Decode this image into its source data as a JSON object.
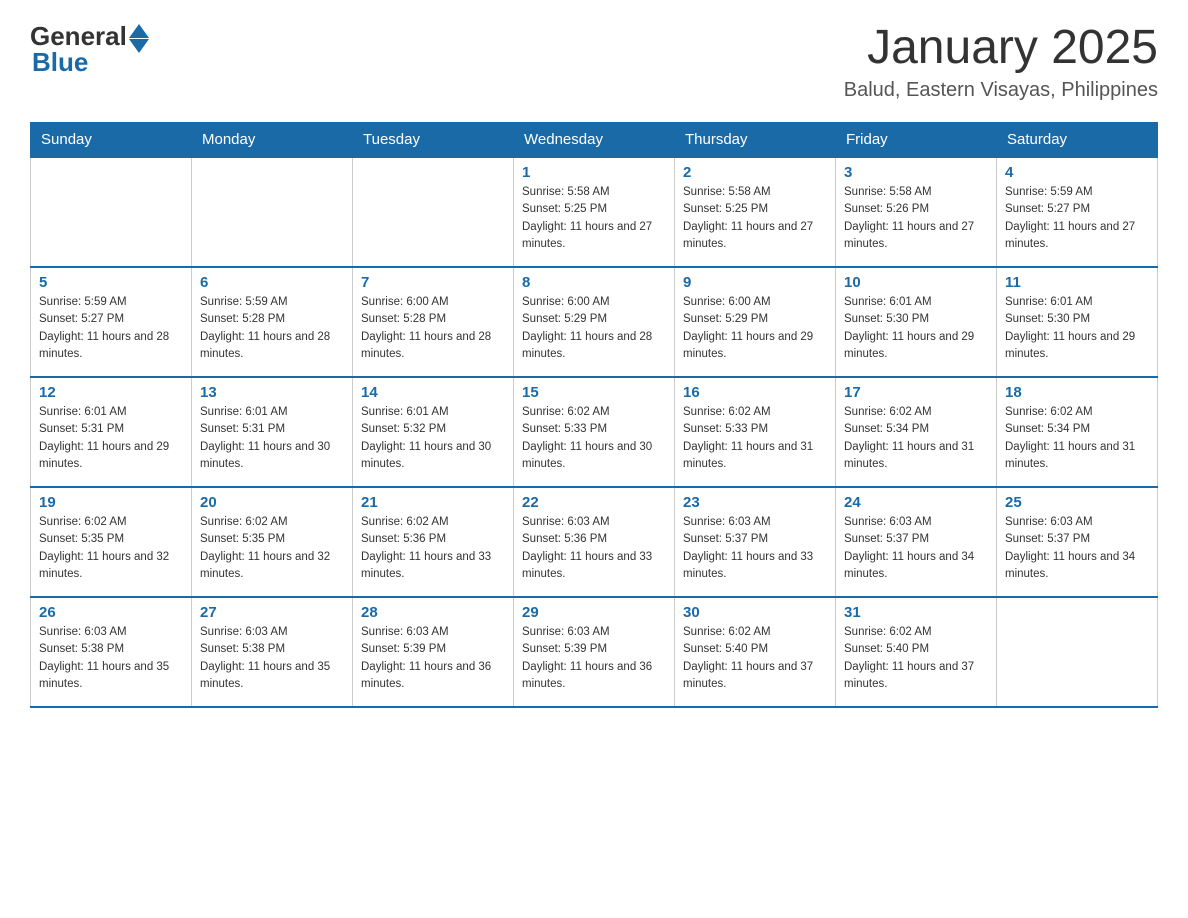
{
  "header": {
    "logo_general": "General",
    "logo_blue": "Blue",
    "month_title": "January 2025",
    "location": "Balud, Eastern Visayas, Philippines"
  },
  "days_of_week": [
    "Sunday",
    "Monday",
    "Tuesday",
    "Wednesday",
    "Thursday",
    "Friday",
    "Saturday"
  ],
  "weeks": [
    [
      {
        "day": "",
        "info": ""
      },
      {
        "day": "",
        "info": ""
      },
      {
        "day": "",
        "info": ""
      },
      {
        "day": "1",
        "info": "Sunrise: 5:58 AM\nSunset: 5:25 PM\nDaylight: 11 hours and 27 minutes."
      },
      {
        "day": "2",
        "info": "Sunrise: 5:58 AM\nSunset: 5:25 PM\nDaylight: 11 hours and 27 minutes."
      },
      {
        "day": "3",
        "info": "Sunrise: 5:58 AM\nSunset: 5:26 PM\nDaylight: 11 hours and 27 minutes."
      },
      {
        "day": "4",
        "info": "Sunrise: 5:59 AM\nSunset: 5:27 PM\nDaylight: 11 hours and 27 minutes."
      }
    ],
    [
      {
        "day": "5",
        "info": "Sunrise: 5:59 AM\nSunset: 5:27 PM\nDaylight: 11 hours and 28 minutes."
      },
      {
        "day": "6",
        "info": "Sunrise: 5:59 AM\nSunset: 5:28 PM\nDaylight: 11 hours and 28 minutes."
      },
      {
        "day": "7",
        "info": "Sunrise: 6:00 AM\nSunset: 5:28 PM\nDaylight: 11 hours and 28 minutes."
      },
      {
        "day": "8",
        "info": "Sunrise: 6:00 AM\nSunset: 5:29 PM\nDaylight: 11 hours and 28 minutes."
      },
      {
        "day": "9",
        "info": "Sunrise: 6:00 AM\nSunset: 5:29 PM\nDaylight: 11 hours and 29 minutes."
      },
      {
        "day": "10",
        "info": "Sunrise: 6:01 AM\nSunset: 5:30 PM\nDaylight: 11 hours and 29 minutes."
      },
      {
        "day": "11",
        "info": "Sunrise: 6:01 AM\nSunset: 5:30 PM\nDaylight: 11 hours and 29 minutes."
      }
    ],
    [
      {
        "day": "12",
        "info": "Sunrise: 6:01 AM\nSunset: 5:31 PM\nDaylight: 11 hours and 29 minutes."
      },
      {
        "day": "13",
        "info": "Sunrise: 6:01 AM\nSunset: 5:31 PM\nDaylight: 11 hours and 30 minutes."
      },
      {
        "day": "14",
        "info": "Sunrise: 6:01 AM\nSunset: 5:32 PM\nDaylight: 11 hours and 30 minutes."
      },
      {
        "day": "15",
        "info": "Sunrise: 6:02 AM\nSunset: 5:33 PM\nDaylight: 11 hours and 30 minutes."
      },
      {
        "day": "16",
        "info": "Sunrise: 6:02 AM\nSunset: 5:33 PM\nDaylight: 11 hours and 31 minutes."
      },
      {
        "day": "17",
        "info": "Sunrise: 6:02 AM\nSunset: 5:34 PM\nDaylight: 11 hours and 31 minutes."
      },
      {
        "day": "18",
        "info": "Sunrise: 6:02 AM\nSunset: 5:34 PM\nDaylight: 11 hours and 31 minutes."
      }
    ],
    [
      {
        "day": "19",
        "info": "Sunrise: 6:02 AM\nSunset: 5:35 PM\nDaylight: 11 hours and 32 minutes."
      },
      {
        "day": "20",
        "info": "Sunrise: 6:02 AM\nSunset: 5:35 PM\nDaylight: 11 hours and 32 minutes."
      },
      {
        "day": "21",
        "info": "Sunrise: 6:02 AM\nSunset: 5:36 PM\nDaylight: 11 hours and 33 minutes."
      },
      {
        "day": "22",
        "info": "Sunrise: 6:03 AM\nSunset: 5:36 PM\nDaylight: 11 hours and 33 minutes."
      },
      {
        "day": "23",
        "info": "Sunrise: 6:03 AM\nSunset: 5:37 PM\nDaylight: 11 hours and 33 minutes."
      },
      {
        "day": "24",
        "info": "Sunrise: 6:03 AM\nSunset: 5:37 PM\nDaylight: 11 hours and 34 minutes."
      },
      {
        "day": "25",
        "info": "Sunrise: 6:03 AM\nSunset: 5:37 PM\nDaylight: 11 hours and 34 minutes."
      }
    ],
    [
      {
        "day": "26",
        "info": "Sunrise: 6:03 AM\nSunset: 5:38 PM\nDaylight: 11 hours and 35 minutes."
      },
      {
        "day": "27",
        "info": "Sunrise: 6:03 AM\nSunset: 5:38 PM\nDaylight: 11 hours and 35 minutes."
      },
      {
        "day": "28",
        "info": "Sunrise: 6:03 AM\nSunset: 5:39 PM\nDaylight: 11 hours and 36 minutes."
      },
      {
        "day": "29",
        "info": "Sunrise: 6:03 AM\nSunset: 5:39 PM\nDaylight: 11 hours and 36 minutes."
      },
      {
        "day": "30",
        "info": "Sunrise: 6:02 AM\nSunset: 5:40 PM\nDaylight: 11 hours and 37 minutes."
      },
      {
        "day": "31",
        "info": "Sunrise: 6:02 AM\nSunset: 5:40 PM\nDaylight: 11 hours and 37 minutes."
      },
      {
        "day": "",
        "info": ""
      }
    ]
  ]
}
